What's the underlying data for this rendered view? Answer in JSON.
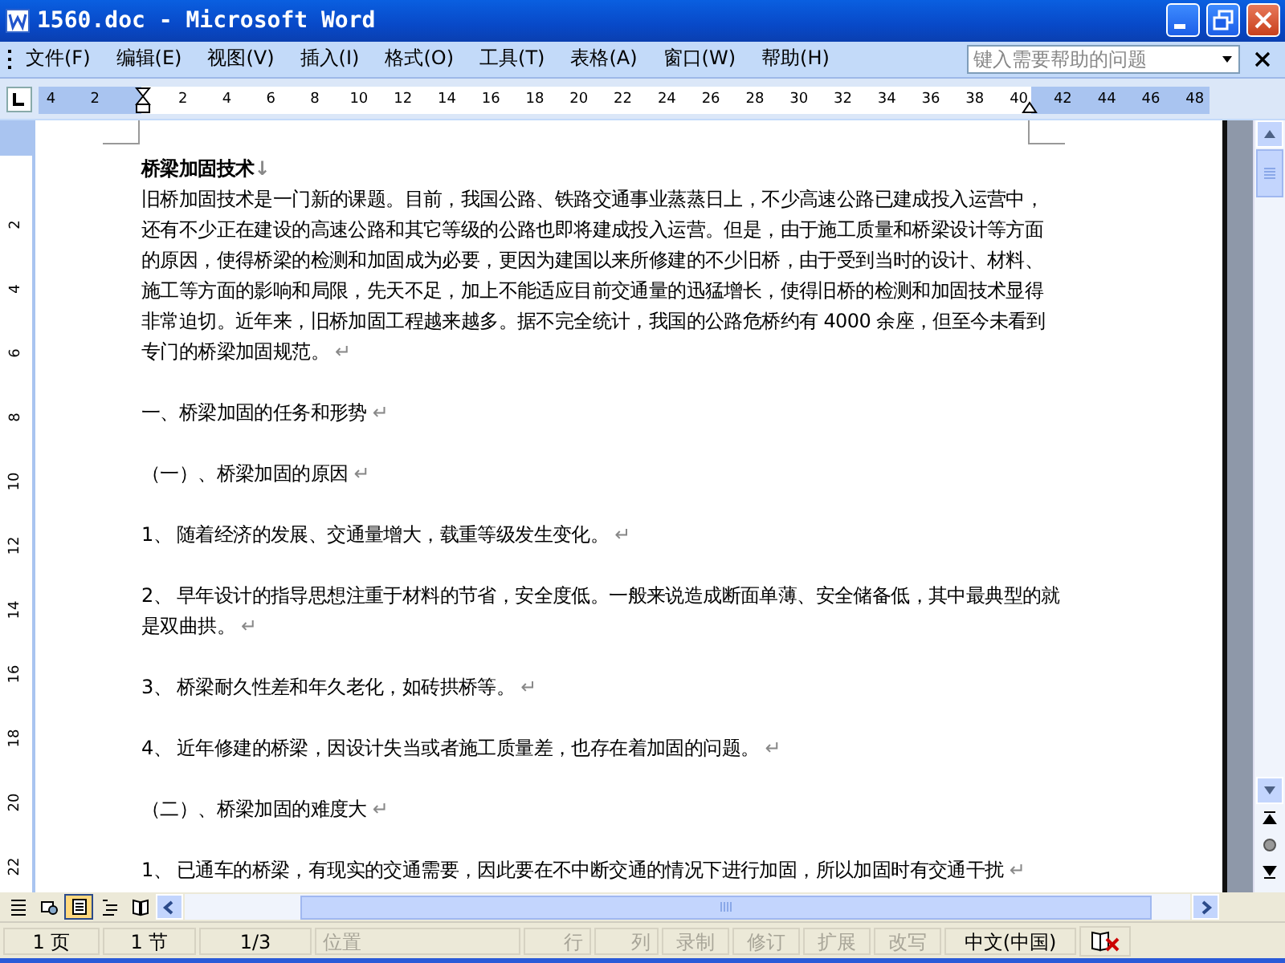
{
  "window": {
    "title": "1560.doc - Microsoft Word"
  },
  "menu": {
    "items": [
      {
        "label": "文件(F)"
      },
      {
        "label": "编辑(E)"
      },
      {
        "label": "视图(V)"
      },
      {
        "label": "插入(I)"
      },
      {
        "label": "格式(O)"
      },
      {
        "label": "工具(T)"
      },
      {
        "label": "表格(A)"
      },
      {
        "label": "窗口(W)"
      },
      {
        "label": "帮助(H)"
      }
    ],
    "help_box": {
      "placeholder": "键入需要帮助的问题"
    }
  },
  "ruler": {
    "left_labels": [
      "4",
      "2"
    ],
    "labels": [
      "2",
      "4",
      "6",
      "8",
      "10",
      "12",
      "14",
      "16",
      "18",
      "20",
      "22",
      "24",
      "26",
      "28",
      "30",
      "32",
      "34",
      "36",
      "38",
      "40",
      "42",
      "44",
      "46",
      "48"
    ]
  },
  "vertical_ruler": {
    "labels": [
      "2",
      "4",
      "6",
      "8",
      "10",
      "12",
      "14",
      "16",
      "18",
      "20",
      "22"
    ]
  },
  "document": {
    "paragraphs": [
      {
        "kind": "title",
        "text": "桥梁加固技术",
        "end_mark": "↓"
      },
      {
        "kind": "body",
        "text": "旧桥加固技术是一门新的课题。目前，我国公路、铁路交通事业蒸蒸日上，不少高速公路已建成投入运营中，还有不少正在建设的高速公路和其它等级的公路也即将建成投入运营。但是，由于施工质量和桥梁设计等方面的原因，使得桥梁的检测和加固成为必要，更因为建国以来所修建的不少旧桥，由于受到当时的设计、材料、施工等方面的影响和局限，先天不足，加上不能适应目前交通量的迅猛增长，使得旧桥的检测和加固技术显得非常迫切。近年来，旧桥加固工程越来越多。据不完全统计，我国的公路危桥约有 4000 余座，但至今未看到专门的桥梁加固规范。",
        "end_mark": "↵"
      },
      {
        "kind": "heading",
        "text": "一、桥梁加固的任务和形势",
        "end_mark": "↵"
      },
      {
        "kind": "heading",
        "text": "（一）、桥梁加固的原因",
        "end_mark": "↵"
      },
      {
        "kind": "item",
        "number": "1、",
        "text": "随着经济的发展、交通量增大，载重等级发生变化。",
        "end_mark": "↵"
      },
      {
        "kind": "item",
        "number": "2、",
        "text": "早年设计的指导思想注重于材料的节省，安全度低。一般来说造成断面单薄、安全储备低，其中最典型的就是双曲拱。",
        "end_mark": "↵"
      },
      {
        "kind": "item",
        "number": "3、",
        "text": "桥梁耐久性差和年久老化，如砖拱桥等。",
        "end_mark": "↵"
      },
      {
        "kind": "item",
        "number": "4、",
        "text": "近年修建的桥梁，因设计失当或者施工质量差，也存在着加固的问题。",
        "end_mark": "↵"
      },
      {
        "kind": "heading",
        "text": "（二）、桥梁加固的难度大",
        "end_mark": "↵"
      },
      {
        "kind": "item",
        "number": "1、",
        "text": "已通车的桥梁，有现实的交通需要，因此要在不中断交通的情况下进行加固，所以加固时有交通干扰",
        "end_mark": "↵"
      }
    ]
  },
  "view_buttons": [
    {
      "kind": "normal",
      "selected": false
    },
    {
      "kind": "web",
      "selected": false
    },
    {
      "kind": "print",
      "selected": true
    },
    {
      "kind": "outline",
      "selected": false
    },
    {
      "kind": "reading",
      "selected": false
    }
  ],
  "status_bar": {
    "fields": [
      {
        "label": "1 页",
        "disabled": false
      },
      {
        "label": "1 节",
        "disabled": false
      },
      {
        "label": "1/3",
        "disabled": false
      },
      {
        "label": "位置",
        "disabled": true
      },
      {
        "label": "行",
        "disabled": true
      },
      {
        "label": "列",
        "disabled": true
      },
      {
        "label": "录制",
        "disabled": true
      },
      {
        "label": "修订",
        "disabled": true
      },
      {
        "label": "扩展",
        "disabled": true
      },
      {
        "label": "改写",
        "disabled": true
      },
      {
        "label": "中文(中国)",
        "disabled": false
      }
    ]
  }
}
